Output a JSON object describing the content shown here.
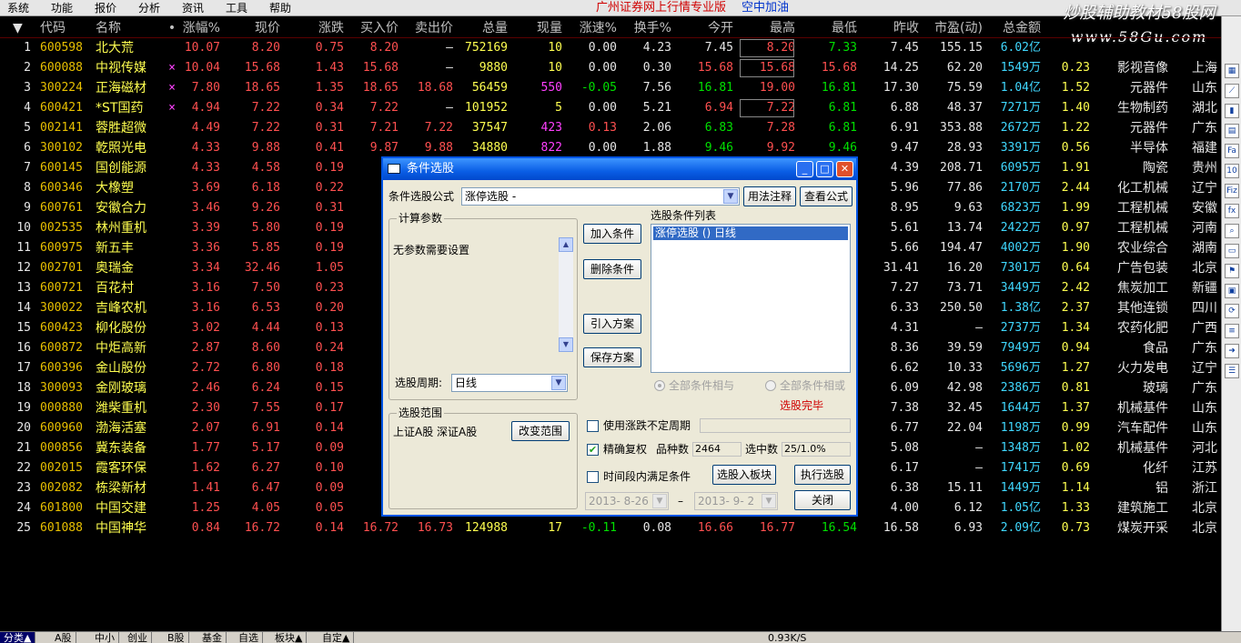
{
  "menu": {
    "items": [
      "系统",
      "功能",
      "报价",
      "分析",
      "资讯",
      "工具",
      "帮助"
    ],
    "app_title": "广州证券网上行情专业版",
    "link": "空中加油"
  },
  "watermark": {
    "line1": "炒股辅助教材58股网",
    "line2": "www.58Gu.com"
  },
  "table": {
    "headers": [
      "代码",
      "名称",
      "•",
      "涨幅%",
      "现价",
      "涨跌",
      "买入价",
      "卖出价",
      "总量",
      "现量",
      "涨速%",
      "换手%",
      "今开",
      "最高",
      "最低",
      "昨收",
      "市盈(动)",
      "总金额"
    ],
    "sort_indicator": "↓",
    "header_arrow": "▼",
    "rows": [
      {
        "n": "1",
        "code": "600598",
        "name": "北大荒",
        "mark": "",
        "chg": "10.07",
        "price": "8.20",
        "delta": "0.75",
        "bid": "8.20",
        "ask": "–",
        "vol": "752169",
        "cur": "10",
        "speed": "0.00",
        "turn": "4.23",
        "open": "7.45",
        "high": "8.20",
        "low": "7.33",
        "prev": "7.45",
        "pe": "155.15",
        "amt": "6.02亿",
        "extra": "",
        "ind": "",
        "reg": ""
      },
      {
        "n": "2",
        "code": "600088",
        "name": "中视传媒",
        "mark": "×",
        "chg": "10.04",
        "price": "15.68",
        "delta": "1.43",
        "bid": "15.68",
        "ask": "–",
        "vol": "9880",
        "cur": "10",
        "speed": "0.00",
        "turn": "0.30",
        "open": "15.68",
        "high": "15.68",
        "low": "15.68",
        "prev": "14.25",
        "pe": "62.20",
        "amt": "1549万",
        "extra": "0.23",
        "ind": "影视音像",
        "reg": "上海"
      },
      {
        "n": "3",
        "code": "300224",
        "name": "正海磁材",
        "mark": "×",
        "chg": "7.80",
        "price": "18.65",
        "delta": "1.35",
        "bid": "18.65",
        "ask": "18.68",
        "vol": "56459",
        "cur": "550",
        "speed": "-0.05",
        "turn": "7.56",
        "open": "16.81",
        "high": "19.00",
        "low": "16.81",
        "prev": "17.30",
        "pe": "75.59",
        "amt": "1.04亿",
        "extra": "1.52",
        "ind": "元器件",
        "reg": "山东"
      },
      {
        "n": "4",
        "code": "600421",
        "name": "*ST国药",
        "mark": "×",
        "chg": "4.94",
        "price": "7.22",
        "delta": "0.34",
        "bid": "7.22",
        "ask": "–",
        "vol": "101952",
        "cur": "5",
        "speed": "0.00",
        "turn": "5.21",
        "open": "6.94",
        "high": "7.22",
        "low": "6.81",
        "prev": "6.88",
        "pe": "48.37",
        "amt": "7271万",
        "extra": "1.40",
        "ind": "生物制药",
        "reg": "湖北"
      },
      {
        "n": "5",
        "code": "002141",
        "name": "蓉胜超微",
        "mark": "",
        "chg": "4.49",
        "price": "7.22",
        "delta": "0.31",
        "bid": "7.21",
        "ask": "7.22",
        "vol": "37547",
        "cur": "423",
        "speed": "0.13",
        "turn": "2.06",
        "open": "6.83",
        "high": "7.28",
        "low": "6.81",
        "prev": "6.91",
        "pe": "353.88",
        "amt": "2672万",
        "extra": "1.22",
        "ind": "元器件",
        "reg": "广东"
      },
      {
        "n": "6",
        "code": "300102",
        "name": "乾照光电",
        "mark": "",
        "chg": "4.33",
        "price": "9.88",
        "delta": "0.41",
        "bid": "9.87",
        "ask": "9.88",
        "vol": "34880",
        "cur": "822",
        "speed": "0.00",
        "turn": "1.88",
        "open": "9.46",
        "high": "9.92",
        "low": "9.46",
        "prev": "9.47",
        "pe": "28.93",
        "amt": "3391万",
        "extra": "0.56",
        "ind": "半导体",
        "reg": "福建"
      },
      {
        "n": "7",
        "code": "600145",
        "name": "国创能源",
        "mark": "",
        "chg": "4.33",
        "price": "4.58",
        "delta": "0.19",
        "bid": "4",
        "ask": "",
        "vol": "",
        "cur": "",
        "speed": "",
        "turn": "",
        "open": "",
        "high": "",
        "low": "",
        "prev": "4.39",
        "pe": "208.71",
        "amt": "6095万",
        "extra": "1.91",
        "ind": "陶瓷",
        "reg": "贵州"
      },
      {
        "n": "8",
        "code": "600346",
        "name": "大橡塑",
        "mark": "",
        "chg": "3.69",
        "price": "6.18",
        "delta": "0.22",
        "bid": "6",
        "ask": "",
        "vol": "",
        "cur": "",
        "speed": "",
        "turn": "",
        "open": "",
        "high": "",
        "low": "",
        "prev": "5.96",
        "pe": "77.86",
        "amt": "2170万",
        "extra": "2.44",
        "ind": "化工机械",
        "reg": "辽宁"
      },
      {
        "n": "9",
        "code": "600761",
        "name": "安徽合力",
        "mark": "",
        "chg": "3.46",
        "price": "9.26",
        "delta": "0.31",
        "bid": "9",
        "ask": "",
        "vol": "",
        "cur": "",
        "speed": "",
        "turn": "",
        "open": "",
        "high": "",
        "low": "",
        "prev": "8.95",
        "pe": "9.63",
        "amt": "6823万",
        "extra": "1.99",
        "ind": "工程机械",
        "reg": "安徽"
      },
      {
        "n": "10",
        "code": "002535",
        "name": "林州重机",
        "mark": "",
        "chg": "3.39",
        "price": "5.80",
        "delta": "0.19",
        "bid": "5",
        "ask": "",
        "vol": "",
        "cur": "",
        "speed": "",
        "turn": "",
        "open": "",
        "high": "",
        "low": "",
        "prev": "5.61",
        "pe": "13.74",
        "amt": "2422万",
        "extra": "0.97",
        "ind": "工程机械",
        "reg": "河南"
      },
      {
        "n": "11",
        "code": "600975",
        "name": "新五丰",
        "mark": "",
        "chg": "3.36",
        "price": "5.85",
        "delta": "0.19",
        "bid": "5",
        "ask": "",
        "vol": "",
        "cur": "",
        "speed": "",
        "turn": "",
        "open": "",
        "high": "",
        "low": "",
        "prev": "5.66",
        "pe": "194.47",
        "amt": "4002万",
        "extra": "1.90",
        "ind": "农业综合",
        "reg": "湖南"
      },
      {
        "n": "12",
        "code": "002701",
        "name": "奥瑞金",
        "mark": "",
        "chg": "3.34",
        "price": "32.46",
        "delta": "1.05",
        "bid": "32",
        "ask": "",
        "vol": "",
        "cur": "",
        "speed": "",
        "turn": "",
        "open": "",
        "high": "",
        "low": "",
        "prev": "31.41",
        "pe": "16.20",
        "amt": "7301万",
        "extra": "0.64",
        "ind": "广告包装",
        "reg": "北京"
      },
      {
        "n": "13",
        "code": "600721",
        "name": "百花村",
        "mark": "",
        "chg": "3.16",
        "price": "7.50",
        "delta": "0.23",
        "bid": "7",
        "ask": "",
        "vol": "",
        "cur": "",
        "speed": "",
        "turn": "",
        "open": "",
        "high": "",
        "low": "",
        "prev": "7.27",
        "pe": "73.71",
        "amt": "3449万",
        "extra": "2.42",
        "ind": "焦炭加工",
        "reg": "新疆"
      },
      {
        "n": "14",
        "code": "300022",
        "name": "吉峰农机",
        "mark": "",
        "chg": "3.16",
        "price": "6.53",
        "delta": "0.20",
        "bid": "6",
        "ask": "",
        "vol": "",
        "cur": "",
        "speed": "",
        "turn": "",
        "open": "",
        "high": "",
        "low": "",
        "prev": "6.33",
        "pe": "250.50",
        "amt": "1.38亿",
        "extra": "2.37",
        "ind": "其他连锁",
        "reg": "四川"
      },
      {
        "n": "15",
        "code": "600423",
        "name": "柳化股份",
        "mark": "",
        "chg": "3.02",
        "price": "4.44",
        "delta": "0.13",
        "bid": "4",
        "ask": "",
        "vol": "",
        "cur": "",
        "speed": "",
        "turn": "",
        "open": "",
        "high": "",
        "low": "",
        "prev": "4.31",
        "pe": "–",
        "amt": "2737万",
        "extra": "1.34",
        "ind": "农药化肥",
        "reg": "广西"
      },
      {
        "n": "16",
        "code": "600872",
        "name": "中炬高新",
        "mark": "",
        "chg": "2.87",
        "price": "8.60",
        "delta": "0.24",
        "bid": "8",
        "ask": "",
        "vol": "",
        "cur": "",
        "speed": "",
        "turn": "",
        "open": "",
        "high": "",
        "low": "",
        "prev": "8.36",
        "pe": "39.59",
        "amt": "7949万",
        "extra": "0.94",
        "ind": "食品",
        "reg": "广东"
      },
      {
        "n": "17",
        "code": "600396",
        "name": "金山股份",
        "mark": "",
        "chg": "2.72",
        "price": "6.80",
        "delta": "0.18",
        "bid": "6",
        "ask": "",
        "vol": "",
        "cur": "",
        "speed": "",
        "turn": "",
        "open": "",
        "high": "",
        "low": "",
        "prev": "6.62",
        "pe": "10.33",
        "amt": "5696万",
        "extra": "1.27",
        "ind": "火力发电",
        "reg": "辽宁"
      },
      {
        "n": "18",
        "code": "300093",
        "name": "金刚玻璃",
        "mark": "",
        "chg": "2.46",
        "price": "6.24",
        "delta": "0.15",
        "bid": "6",
        "ask": "",
        "vol": "",
        "cur": "",
        "speed": "",
        "turn": "",
        "open": "",
        "high": "",
        "low": "",
        "prev": "6.09",
        "pe": "42.98",
        "amt": "2386万",
        "extra": "0.81",
        "ind": "玻璃",
        "reg": "广东"
      },
      {
        "n": "19",
        "code": "000880",
        "name": "潍柴重机",
        "mark": "",
        "chg": "2.30",
        "price": "7.55",
        "delta": "0.17",
        "bid": "7",
        "ask": "",
        "vol": "",
        "cur": "",
        "speed": "",
        "turn": "",
        "open": "",
        "high": "",
        "low": "",
        "prev": "7.38",
        "pe": "32.45",
        "amt": "1644万",
        "extra": "1.37",
        "ind": "机械基件",
        "reg": "山东"
      },
      {
        "n": "20",
        "code": "600960",
        "name": "渤海活塞",
        "mark": "",
        "chg": "2.07",
        "price": "6.91",
        "delta": "0.14",
        "bid": "6",
        "ask": "",
        "vol": "",
        "cur": "",
        "speed": "",
        "turn": "",
        "open": "",
        "high": "",
        "low": "",
        "prev": "6.77",
        "pe": "22.04",
        "amt": "1198万",
        "extra": "0.99",
        "ind": "汽车配件",
        "reg": "山东"
      },
      {
        "n": "21",
        "code": "000856",
        "name": "冀东装备",
        "mark": "",
        "chg": "1.77",
        "price": "5.17",
        "delta": "0.09",
        "bid": "5",
        "ask": "",
        "vol": "",
        "cur": "",
        "speed": "",
        "turn": "",
        "open": "",
        "high": "",
        "low": "",
        "prev": "5.08",
        "pe": "–",
        "amt": "1348万",
        "extra": "1.02",
        "ind": "机械基件",
        "reg": "河北"
      },
      {
        "n": "22",
        "code": "002015",
        "name": "霞客环保",
        "mark": "",
        "chg": "1.62",
        "price": "6.27",
        "delta": "0.10",
        "bid": "6",
        "ask": "",
        "vol": "",
        "cur": "",
        "speed": "",
        "turn": "",
        "open": "",
        "high": "",
        "low": "",
        "prev": "6.17",
        "pe": "–",
        "amt": "1741万",
        "extra": "0.69",
        "ind": "化纤",
        "reg": "江苏"
      },
      {
        "n": "23",
        "code": "002082",
        "name": "栋梁新材",
        "mark": "",
        "chg": "1.41",
        "price": "6.47",
        "delta": "0.09",
        "bid": "6",
        "ask": "",
        "vol": "",
        "cur": "",
        "speed": "",
        "turn": "",
        "open": "",
        "high": "",
        "low": "",
        "prev": "6.38",
        "pe": "15.11",
        "amt": "1449万",
        "extra": "1.14",
        "ind": "铝",
        "reg": "浙江"
      },
      {
        "n": "24",
        "code": "601800",
        "name": "中国交建",
        "mark": "",
        "chg": "1.25",
        "price": "4.05",
        "delta": "0.05",
        "bid": "4",
        "ask": "",
        "vol": "",
        "cur": "",
        "speed": "",
        "turn": "",
        "open": "",
        "high": "",
        "low": "",
        "prev": "4.00",
        "pe": "6.12",
        "amt": "1.05亿",
        "extra": "1.33",
        "ind": "建筑施工",
        "reg": "北京"
      },
      {
        "n": "25",
        "code": "601088",
        "name": "中国神华",
        "mark": "",
        "chg": "0.84",
        "price": "16.72",
        "delta": "0.14",
        "bid": "16.72",
        "ask": "16.73",
        "vol": "124988",
        "cur": "17",
        "speed": "-0.11",
        "turn": "0.08",
        "open": "16.66",
        "high": "16.77",
        "low": "16.54",
        "prev": "16.58",
        "pe": "6.93",
        "amt": "2.09亿",
        "extra": "0.73",
        "ind": "煤炭开采",
        "reg": "北京"
      }
    ]
  },
  "bottom_tabs": [
    "分类▲",
    "A股",
    "中小",
    "创业",
    "B股",
    "基金",
    "自选",
    "板块▲",
    "自定▲"
  ],
  "bottom_status": "0.93K/S",
  "dialog": {
    "title": "条件选股",
    "formula_label": "条件选股公式",
    "formula_value": "涨停选股 -",
    "usage_button": "用法注释",
    "view_formula_button": "查看公式",
    "calc_params_label": "计算参数",
    "no_params_text": "无参数需要设置",
    "period_label": "选股周期:",
    "period_value": "日线",
    "add_condition": "加入条件",
    "delete_condition": "删除条件",
    "import_scheme": "引入方案",
    "save_scheme": "保存方案",
    "condition_list_label": "选股条件列表",
    "condition_item": "涨停选股  () 日线",
    "radio_and": "全部条件相与",
    "radio_or": "全部条件相或",
    "status_text": "选股完毕",
    "scope_label": "选股范围",
    "scope_value": "上证A股 深证A股",
    "change_scope": "改变范围",
    "use_irregular_period": "使用涨跌不定周期",
    "exact_adjust": "精确复权",
    "count_label": "品种数",
    "count_value": "2464",
    "hits_label": "选中数",
    "hits_value": "25/1.0%",
    "time_range_label": "时间段内满足条件",
    "to_block_button": "选股入板块",
    "run_button": "执行选股",
    "close_button": "关闭",
    "date_from": "2013- 8-26",
    "date_sep": "–",
    "date_to": "2013- 9- 2",
    "title_buttons": {
      "min": "_",
      "max": "□",
      "close": "✕"
    }
  },
  "colors": {
    "up": "#ff5050",
    "down": "#00e000",
    "flat": "#e6e6e6",
    "amount": "#40d8ff",
    "code": "#e8c000",
    "titlebar": "#0a5ee5"
  },
  "icons": [
    "grid-icon",
    "chart-icon",
    "kline-icon",
    "bars-icon",
    "fa-icon",
    "f10-icon",
    "fiz-icon",
    "fx-icon",
    "search-icon",
    "window-icon",
    "flag-icon",
    "box-icon",
    "refresh-icon",
    "eff-icon",
    "arrow-icon",
    "stack-icon"
  ]
}
